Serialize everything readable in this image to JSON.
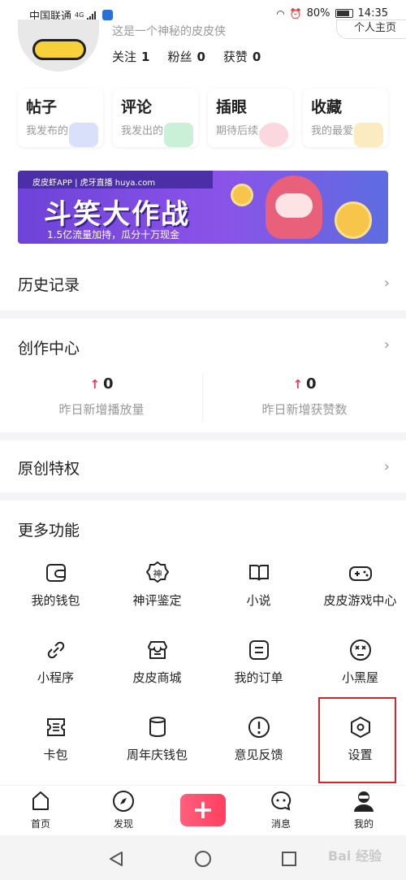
{
  "status_bar": {
    "carrier": "中国联通",
    "network": "4G",
    "battery": "80%",
    "time": "14:35"
  },
  "profile": {
    "bio": "这是一个神秘的皮皮侠",
    "top_button": "个人主页",
    "stats": [
      {
        "label": "关注",
        "value": "1"
      },
      {
        "label": "粉丝",
        "value": "0"
      },
      {
        "label": "获赞",
        "value": "0"
      }
    ],
    "cards": [
      {
        "title": "帖子",
        "subtitle": "我发布的",
        "color": "#b9c8f6"
      },
      {
        "title": "评论",
        "subtitle": "我发出的",
        "color": "#9fe3b6"
      },
      {
        "title": "插眼",
        "subtitle": "期待后续",
        "color": "#f7b8c4"
      },
      {
        "title": "收藏",
        "subtitle": "我的最爱",
        "color": "#f6dc8c"
      }
    ]
  },
  "banner": {
    "brand_line": "皮皮虾APP | 虎牙直播 huya.com",
    "headline": "斗笑大作战",
    "subline": "1.5亿流量加持，瓜分十万现金"
  },
  "history": {
    "title": "历史记录"
  },
  "creator": {
    "title": "创作中心",
    "stats": [
      {
        "value": "0",
        "label": "昨日新增播放量"
      },
      {
        "value": "0",
        "label": "昨日新增获赞数"
      }
    ]
  },
  "original": {
    "title": "原创特权"
  },
  "more": {
    "title": "更多功能",
    "items": [
      {
        "label": "我的钱包",
        "icon": "wallet-icon"
      },
      {
        "label": "神评鉴定",
        "icon": "shen-badge-icon"
      },
      {
        "label": "小说",
        "icon": "book-icon"
      },
      {
        "label": "皮皮游戏中心",
        "icon": "gamepad-icon"
      },
      {
        "label": "小程序",
        "icon": "link-icon"
      },
      {
        "label": "皮皮商城",
        "icon": "shop-icon"
      },
      {
        "label": "我的订单",
        "icon": "order-icon"
      },
      {
        "label": "小黑屋",
        "icon": "dizzy-face-icon"
      },
      {
        "label": "卡包",
        "icon": "ticket-icon"
      },
      {
        "label": "周年庆钱包",
        "icon": "jar-icon"
      },
      {
        "label": "意见反馈",
        "icon": "alert-icon"
      },
      {
        "label": "设置",
        "icon": "hexagon-settings-icon"
      }
    ]
  },
  "bottom_nav": {
    "items": [
      {
        "label": "首页",
        "icon": "home-icon"
      },
      {
        "label": "发现",
        "icon": "compass-icon"
      },
      {
        "label": "+",
        "icon": "plus-icon"
      },
      {
        "label": "消息",
        "icon": "chat-icon"
      },
      {
        "label": "我的",
        "icon": "user-icon"
      }
    ]
  },
  "colors": {
    "accent": "#ff4766",
    "highlight_box": "#d0262f"
  },
  "watermark": "Bai 经验"
}
